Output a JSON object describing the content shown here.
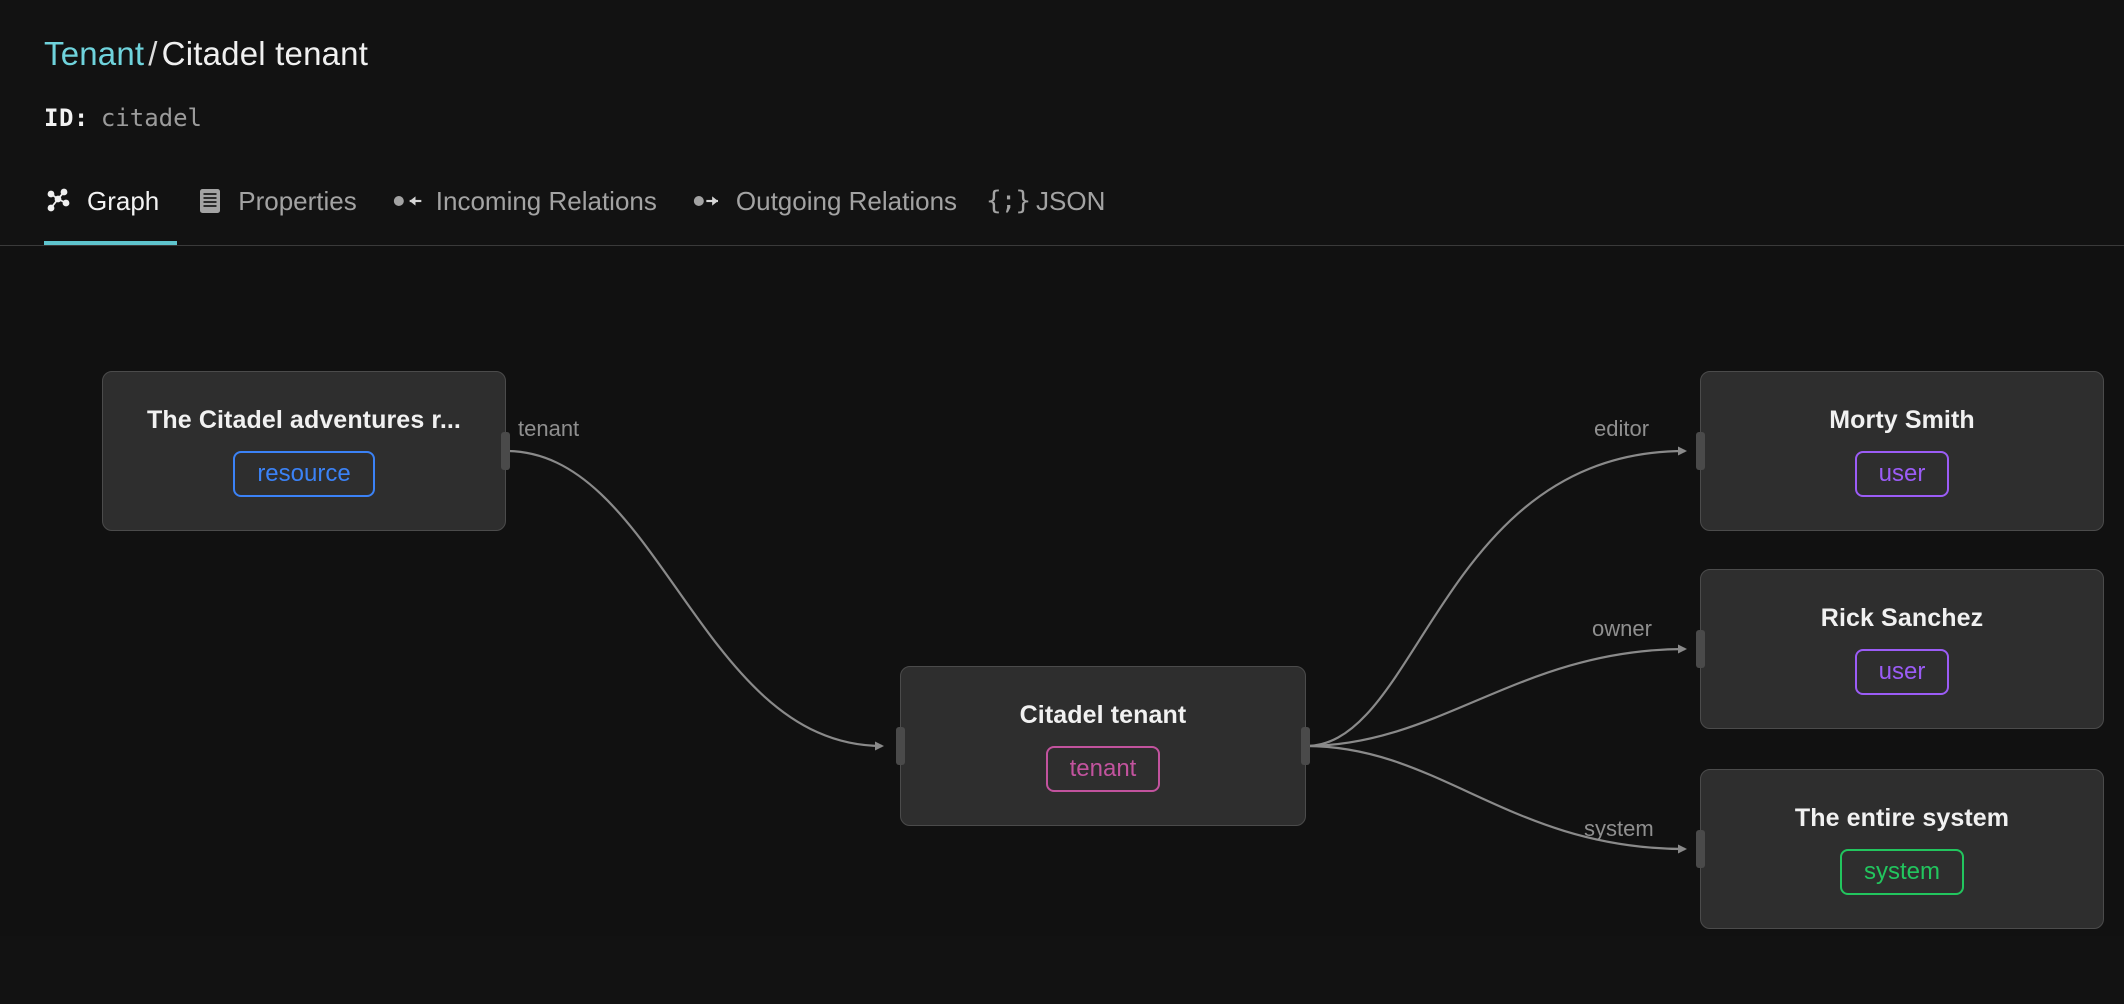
{
  "header": {
    "breadcrumb": {
      "parent": "Tenant",
      "separator": "/",
      "current": "Citadel tenant"
    },
    "id_label": "ID:",
    "id_value": "citadel"
  },
  "tabs": [
    {
      "label": "Graph",
      "icon": "graph-nodes-icon",
      "active": true
    },
    {
      "label": "Properties",
      "icon": "list-document-icon",
      "active": false
    },
    {
      "label": "Incoming Relations",
      "icon": "arrow-in-icon",
      "active": false
    },
    {
      "label": "Outgoing Relations",
      "icon": "arrow-out-icon",
      "active": false
    },
    {
      "label": "JSON",
      "icon": "curly-braces-icon",
      "active": false
    }
  ],
  "graph": {
    "nodes": [
      {
        "id": "resource",
        "title": "The Citadel adventures r...",
        "badge": "resource",
        "badge_color": "#3b82f6"
      },
      {
        "id": "tenant",
        "title": "Citadel tenant",
        "badge": "tenant",
        "badge_color": "#c2539e"
      },
      {
        "id": "morty",
        "title": "Morty Smith",
        "badge": "user",
        "badge_color": "#9b5cf6"
      },
      {
        "id": "rick",
        "title": "Rick Sanchez",
        "badge": "user",
        "badge_color": "#9b5cf6"
      },
      {
        "id": "system",
        "title": "The entire system",
        "badge": "system",
        "badge_color": "#22c55e"
      }
    ],
    "edges": [
      {
        "from": "resource",
        "to": "tenant",
        "label": "tenant"
      },
      {
        "from": "tenant",
        "to": "morty",
        "label": "editor"
      },
      {
        "from": "tenant",
        "to": "rick",
        "label": "owner"
      },
      {
        "from": "tenant",
        "to": "system",
        "label": "system"
      }
    ]
  },
  "colors": {
    "accent": "#5ec4cd",
    "background": "#121212",
    "canvas": "#111111",
    "node_bg": "#2e2e2e",
    "node_border": "#4b4b4b",
    "edge": "#8a8a8a",
    "muted_text": "#a3a3a3"
  }
}
